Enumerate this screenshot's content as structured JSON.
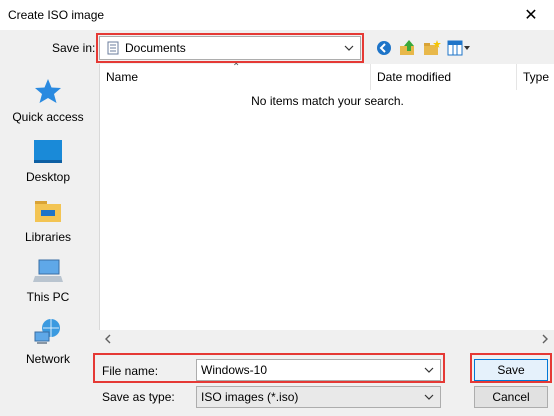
{
  "window": {
    "title": "Create ISO image",
    "close_glyph": "✕"
  },
  "save_in": {
    "label": "Save in:",
    "value": "Documents"
  },
  "toolbar": {
    "icons": [
      "back-icon",
      "up-folder-icon",
      "new-folder-icon",
      "view-menu-icon"
    ]
  },
  "places": [
    {
      "label": "Quick access",
      "icon": "star-icon"
    },
    {
      "label": "Desktop",
      "icon": "desktop-icon"
    },
    {
      "label": "Libraries",
      "icon": "libraries-icon"
    },
    {
      "label": "This PC",
      "icon": "computer-icon"
    },
    {
      "label": "Network",
      "icon": "network-icon"
    }
  ],
  "file_list": {
    "columns": [
      "Name",
      "Date modified",
      "Type"
    ],
    "empty_message": "No items match your search."
  },
  "file_name": {
    "label": "File name:",
    "value": "Windows-10"
  },
  "save_as_type": {
    "label": "Save as type:",
    "value": "ISO images (*.iso)"
  },
  "buttons": {
    "save": "Save",
    "cancel": "Cancel"
  },
  "colors": {
    "highlight": "#e53935",
    "accent": "#0078d7"
  }
}
